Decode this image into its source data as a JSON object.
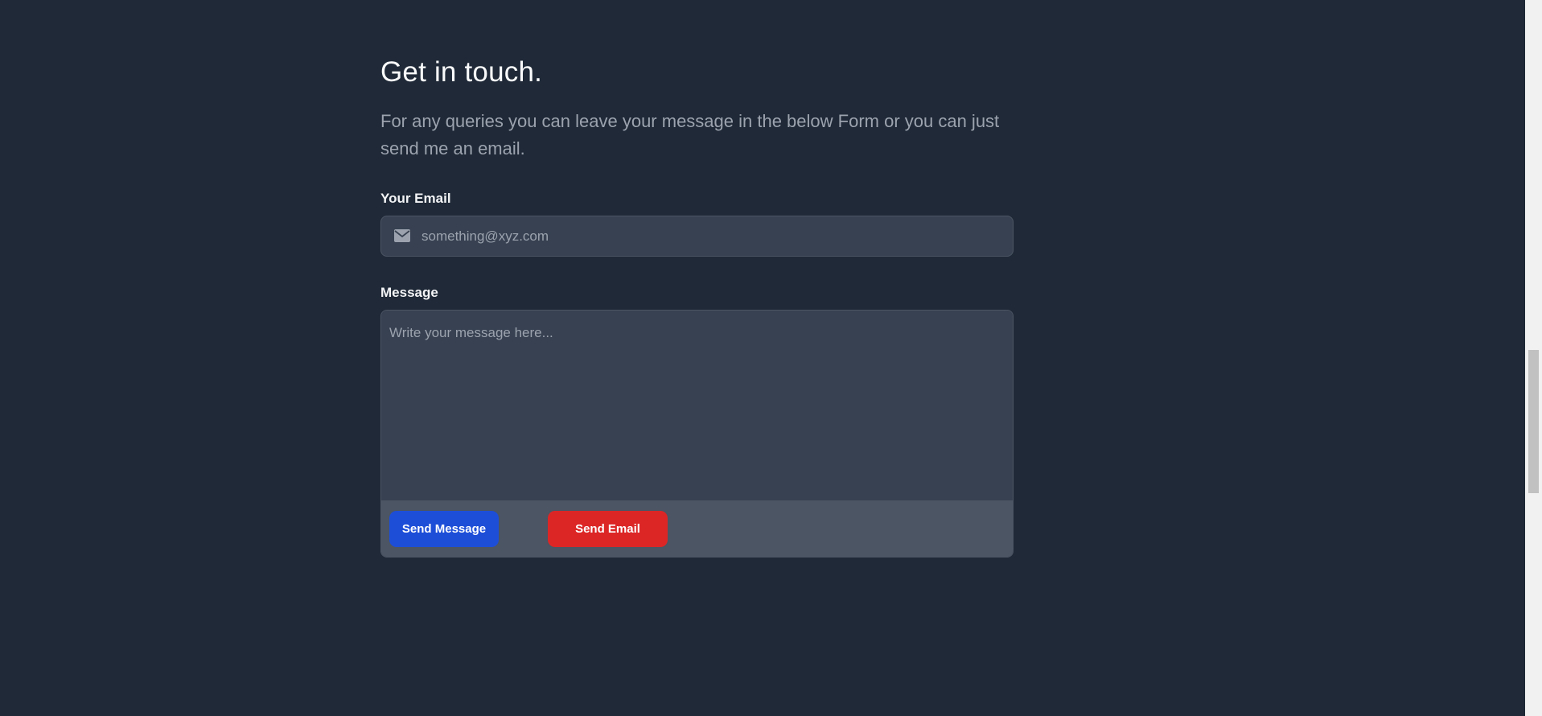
{
  "contact": {
    "heading": "Get in touch.",
    "description": "For any queries you can leave your message in the below Form or you can just send me an email.",
    "email": {
      "label": "Your Email",
      "placeholder": "something@xyz.com",
      "value": "",
      "icon": "envelope-icon"
    },
    "message": {
      "label": "Message",
      "placeholder": "Write your message here...",
      "value": ""
    },
    "buttons": {
      "send_message": "Send Message",
      "send_email": "Send Email"
    }
  },
  "colors": {
    "background": "#1f2937",
    "input_background": "#374151",
    "footer_background": "#4b5563",
    "send_message_button": "#1d4ed8",
    "send_email_button": "#dc2626"
  }
}
